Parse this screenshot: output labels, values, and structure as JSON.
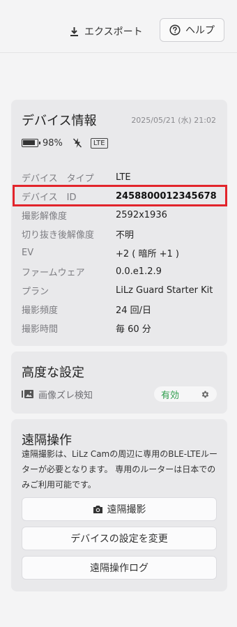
{
  "header": {
    "export_label": "エクスポート",
    "export_icon": "download-icon",
    "help_label": "ヘルプ",
    "help_icon": "question-circle-icon"
  },
  "device_info": {
    "title": "デバイス情報",
    "timestamp": "2025/05/21 (水) 21:02",
    "battery_percent": "98%",
    "battery_icon": "battery-icon",
    "flash_icon": "flash-off-icon",
    "network_badge": "LTE",
    "rows": [
      {
        "label": "デバイス　タイプ",
        "value": "LTE"
      },
      {
        "label": "デバイス　ID",
        "value": "2458800012345678"
      },
      {
        "label": "撮影解像度",
        "value": "2592x1936"
      },
      {
        "label": "切り抜き後解像度",
        "value": "不明"
      },
      {
        "label": "EV",
        "value": "+2 ( 暗所 +1 )"
      },
      {
        "label": "ファームウェア",
        "value": "0.0.e1.2.9"
      },
      {
        "label": "プラン",
        "value": "LiLz Guard Starter Kit"
      },
      {
        "label": "撮影頻度",
        "value": "24 回/日"
      },
      {
        "label": "撮影時間",
        "value": "毎 60 分"
      }
    ],
    "highlight_color": "#e2242b"
  },
  "advanced": {
    "title": "高度な設定",
    "setting_label": "画像ズレ検知",
    "setting_icon": "image-gallery-icon",
    "setting_state": "有効",
    "state_color": "#2e9d4c",
    "gear_icon": "gear-icon"
  },
  "remote": {
    "title": "遠隔操作",
    "description": "遠隔撮影は、LiLz Camの周辺に専用のBLE-LTEルーターが必要となります。 専用のルーターは日本でのみご利用可能です。",
    "buttons": [
      {
        "label": "遠隔撮影",
        "icon": "camera-icon"
      },
      {
        "label": "デバイスの設定を変更"
      },
      {
        "label": "遠隔操作ログ"
      }
    ]
  }
}
